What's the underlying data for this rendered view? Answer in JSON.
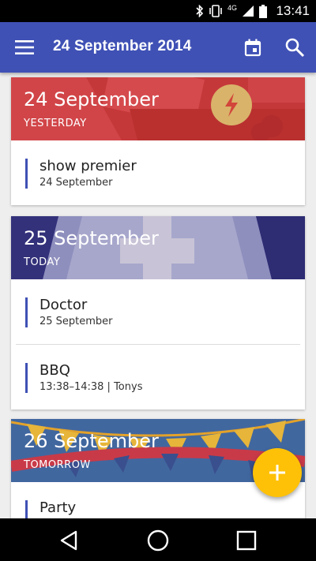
{
  "status_bar": {
    "time": "13:41",
    "network": "4G",
    "icons": [
      "bluetooth-icon",
      "vibrate-icon",
      "signal-icon",
      "battery-icon"
    ]
  },
  "app_bar": {
    "title": "24 September 2014",
    "icons": [
      "menu-icon",
      "calendar-icon",
      "search-icon"
    ],
    "color": "#3f51b5"
  },
  "days": [
    {
      "date": "24 September",
      "relative": "YESTERDAY",
      "header_color": "#c8393a",
      "events": [
        {
          "name": "show premier",
          "detail": "24 September"
        }
      ]
    },
    {
      "date": "25 September",
      "relative": "TODAY",
      "header_color": "#3c3a8c",
      "events": [
        {
          "name": "Doctor",
          "detail": "25 September"
        },
        {
          "name": "BBQ",
          "detail": "13:38–14:38 | Tonys"
        }
      ]
    },
    {
      "date": "26 September",
      "relative": "TOMORROW",
      "header_color": "#3f6aa8",
      "events": [
        {
          "name": "Party",
          "detail": ""
        }
      ]
    }
  ],
  "fab": {
    "icon": "plus-icon",
    "color": "#ffc107"
  },
  "nav_bar": {
    "icons": [
      "back-icon",
      "home-icon",
      "recents-icon"
    ]
  }
}
